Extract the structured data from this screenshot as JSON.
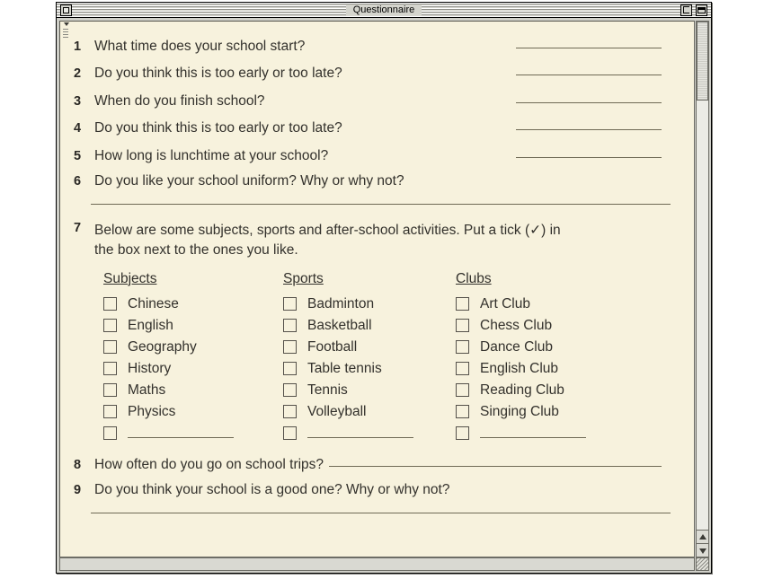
{
  "window": {
    "title": "Questionnaire",
    "close_box": "close-box",
    "zoom_box": "zoom-box",
    "collapse_box": "collapse-box"
  },
  "colors": {
    "paper": "#f7f2dd",
    "ink": "#33312c",
    "rule": "#6f6a55",
    "chrome": "#cfcfc8"
  },
  "questions": [
    {
      "num": "1",
      "text": "What time does your school start?",
      "line": "right"
    },
    {
      "num": "2",
      "text": "Do you think this is too early or too late?",
      "line": "right"
    },
    {
      "num": "3",
      "text": "When do you finish school?",
      "line": "right"
    },
    {
      "num": "4",
      "text": "Do you think this is too early or too late?",
      "line": "right"
    },
    {
      "num": "5",
      "text": "How long is lunchtime at your school?",
      "line": "right"
    },
    {
      "num": "6",
      "text": "Do you like your school uniform? Why or why not?",
      "line": "below"
    }
  ],
  "q7": {
    "num": "7",
    "line1": "Below are some subjects, sports and after-school activities. Put a tick (✓) in",
    "line2": "the box next to the ones you like.",
    "columns": [
      {
        "heading": "Subjects",
        "options": [
          "Chinese",
          "English",
          "Geography",
          "History",
          "Maths",
          "Physics"
        ],
        "write_in": true
      },
      {
        "heading": "Sports",
        "options": [
          "Badminton",
          "Basketball",
          "Football",
          "Table tennis",
          "Tennis",
          "Volleyball"
        ],
        "write_in": true
      },
      {
        "heading": "Clubs",
        "options": [
          "Art Club",
          "Chess Club",
          "Dance Club",
          "English Club",
          "Reading Club",
          "Singing Club"
        ],
        "write_in": true
      }
    ]
  },
  "q8": {
    "num": "8",
    "text": "How often do you go on school trips?",
    "line": "inline"
  },
  "q9": {
    "num": "9",
    "text": "Do you think your school is a good one? Why or why not?",
    "line": "below"
  }
}
